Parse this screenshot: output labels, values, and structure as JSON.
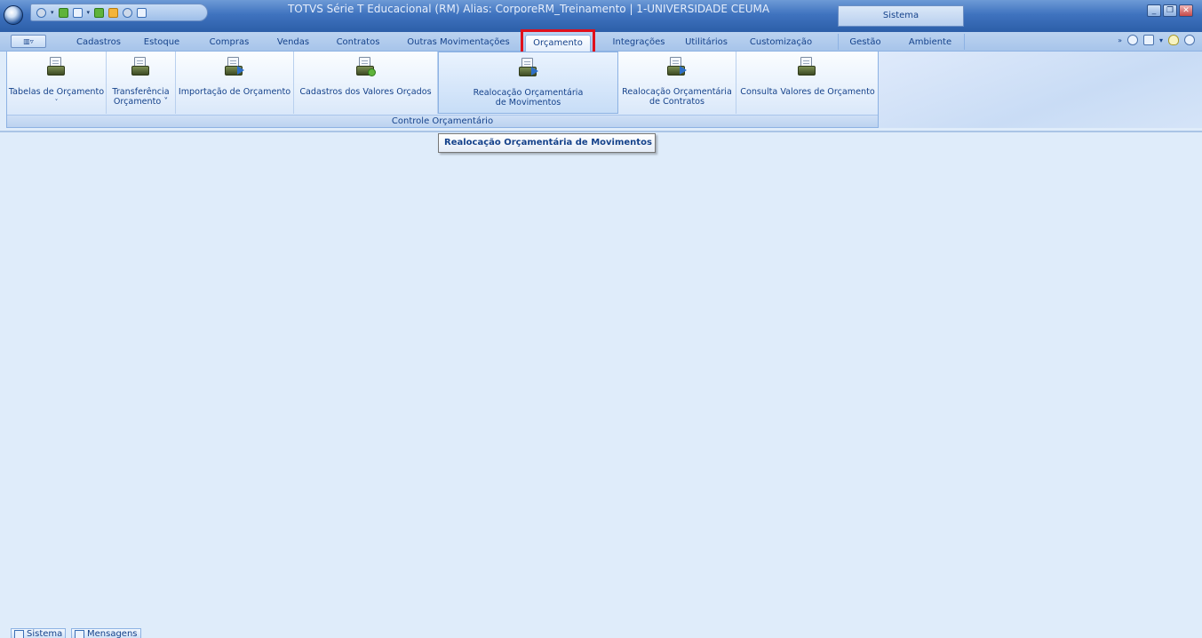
{
  "window": {
    "title": "TOTVS Série T Educacional (RM) Alias: CorporeRM_Treinamento | 1-UNIVERSIDADE CEUMA",
    "context_box": "Sistema"
  },
  "menu": {
    "tabs": [
      {
        "label": "Cadastros"
      },
      {
        "label": "Estoque"
      },
      {
        "label": "Compras"
      },
      {
        "label": "Vendas"
      },
      {
        "label": "Contratos"
      },
      {
        "label": "Outras Movimentações"
      },
      {
        "label": "Orçamento"
      },
      {
        "label": "Integrações"
      },
      {
        "label": "Utilitários"
      },
      {
        "label": "Customização"
      },
      {
        "label": "Gestão"
      },
      {
        "label": "Ambiente"
      }
    ],
    "active_tab": "Orçamento"
  },
  "ribbon": {
    "group_label": "Controle Orçamentário",
    "buttons": [
      {
        "line1": "Tabelas de Orçamento",
        "line2": "˅"
      },
      {
        "line1": "Transferência",
        "line2": "Orçamento ˅"
      },
      {
        "line1": "Importação de Orçamento",
        "line2": ""
      },
      {
        "line1": "Cadastros dos Valores Orçados",
        "line2": ""
      },
      {
        "line1": "Realocação Orçamentária",
        "line2": "de Movimentos"
      },
      {
        "line1": "Realocação Orçamentária",
        "line2": "de Contratos"
      },
      {
        "line1": "Consulta Valores de Orçamento",
        "line2": ""
      }
    ]
  },
  "tooltip": {
    "text": "Realocação Orçamentária de Movimentos"
  },
  "taskbar": {
    "items": [
      {
        "label": "Sistema"
      },
      {
        "label": "Mensagens"
      }
    ]
  }
}
